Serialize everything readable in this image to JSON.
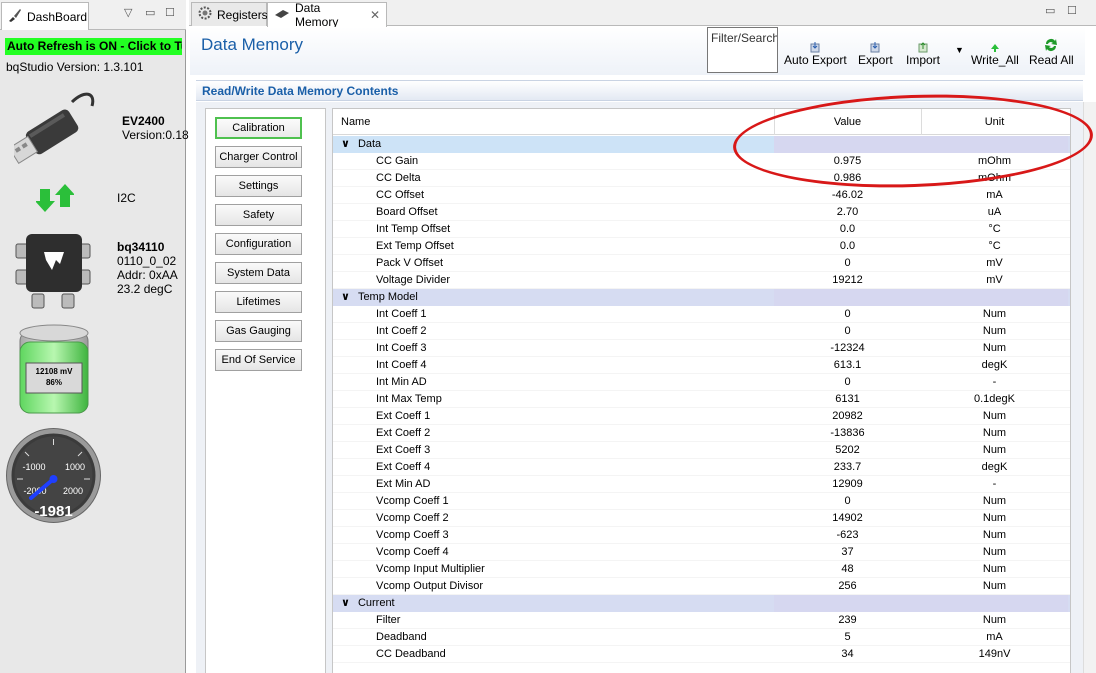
{
  "dashboard": {
    "tab_label": "DashBoard",
    "auto_refresh": "Auto Refresh is ON - Click to Tu",
    "bqstudio_version": "bqStudio Version:  1.3.101",
    "adapter": {
      "name": "EV2400",
      "version": "Version:0.18"
    },
    "bus": "I2C",
    "device": {
      "name": "bq34110",
      "fw": "0110_0_02",
      "addr": "Addr: 0xAA",
      "temp": "23.2 degC"
    },
    "battery": {
      "voltage": "12108 mV",
      "percent": "86%",
      "level": 0.86
    },
    "gauge": {
      "value": "-1981",
      "tick_neg1000": "-1000",
      "tick_1000": "1000",
      "tick_neg2000": "-2000",
      "tick_2000": "2000"
    }
  },
  "editor_tabs": [
    {
      "label": "Registers",
      "icon": "gear-icon"
    },
    {
      "label": "Data Memory",
      "icon": "chip-icon",
      "active": true
    }
  ],
  "header": {
    "title": "Data Memory",
    "filter_placeholder": "Filter/Search",
    "buttons": {
      "auto_export": "Auto Export",
      "export": "Export",
      "import": "Import",
      "write_all": "Write_All",
      "read_all": "Read All"
    }
  },
  "section_title": "Read/Write Data Memory Contents",
  "categories": [
    "Calibration",
    "Charger Control",
    "Settings",
    "Safety",
    "Configuration",
    "System Data",
    "Lifetimes",
    "Gas Gauging",
    "End Of Service"
  ],
  "selected_category": "Calibration",
  "table": {
    "columns": {
      "name": "Name",
      "value": "Value",
      "unit": "Unit"
    },
    "groups": [
      {
        "name": "Data",
        "rows": [
          {
            "name": "CC Gain",
            "value": "0.975",
            "unit": "mOhm"
          },
          {
            "name": "CC Delta",
            "value": "0.986",
            "unit": "mOhm"
          },
          {
            "name": "CC Offset",
            "value": "-46.02",
            "unit": "mA"
          },
          {
            "name": "Board Offset",
            "value": "2.70",
            "unit": "uA"
          },
          {
            "name": "Int Temp Offset",
            "value": "0.0",
            "unit": "°C"
          },
          {
            "name": "Ext Temp Offset",
            "value": "0.0",
            "unit": "°C"
          },
          {
            "name": "Pack V Offset",
            "value": "0",
            "unit": "mV"
          },
          {
            "name": "Voltage Divider",
            "value": "19212",
            "unit": "mV"
          }
        ]
      },
      {
        "name": "Temp Model",
        "rows": [
          {
            "name": "Int Coeff 1",
            "value": "0",
            "unit": "Num"
          },
          {
            "name": "Int Coeff 2",
            "value": "0",
            "unit": "Num"
          },
          {
            "name": "Int Coeff 3",
            "value": "-12324",
            "unit": "Num"
          },
          {
            "name": "Int Coeff 4",
            "value": "613.1",
            "unit": "degK"
          },
          {
            "name": "Int Min AD",
            "value": "0",
            "unit": "-"
          },
          {
            "name": "Int Max Temp",
            "value": "6131",
            "unit": "0.1degK"
          },
          {
            "name": "Ext Coeff 1",
            "value": "20982",
            "unit": "Num"
          },
          {
            "name": "Ext Coeff 2",
            "value": "-13836",
            "unit": "Num"
          },
          {
            "name": "Ext Coeff 3",
            "value": "5202",
            "unit": "Num"
          },
          {
            "name": "Ext Coeff 4",
            "value": "233.7",
            "unit": "degK"
          },
          {
            "name": "Ext Min AD",
            "value": "12909",
            "unit": "-"
          },
          {
            "name": "Vcomp Coeff 1",
            "value": "0",
            "unit": "Num"
          },
          {
            "name": "Vcomp Coeff 2",
            "value": "14902",
            "unit": "Num"
          },
          {
            "name": "Vcomp Coeff 3",
            "value": "-623",
            "unit": "Num"
          },
          {
            "name": "Vcomp Coeff 4",
            "value": "37",
            "unit": "Num"
          },
          {
            "name": "Vcomp Input Multiplier",
            "value": "48",
            "unit": "Num"
          },
          {
            "name": "Vcomp Output Divisor",
            "value": "256",
            "unit": "Num"
          }
        ]
      },
      {
        "name": "Current",
        "rows": [
          {
            "name": "Filter",
            "value": "239",
            "unit": "Num"
          },
          {
            "name": "Deadband",
            "value": "5",
            "unit": "mA"
          },
          {
            "name": "CC Deadband",
            "value": "34",
            "unit": "149nV"
          }
        ]
      }
    ]
  },
  "colors": {
    "accent": "#1a5fa8",
    "auto_refresh_bg": "#22ff22",
    "annotation": "#d81818",
    "group_row": "#d6dcf2"
  }
}
